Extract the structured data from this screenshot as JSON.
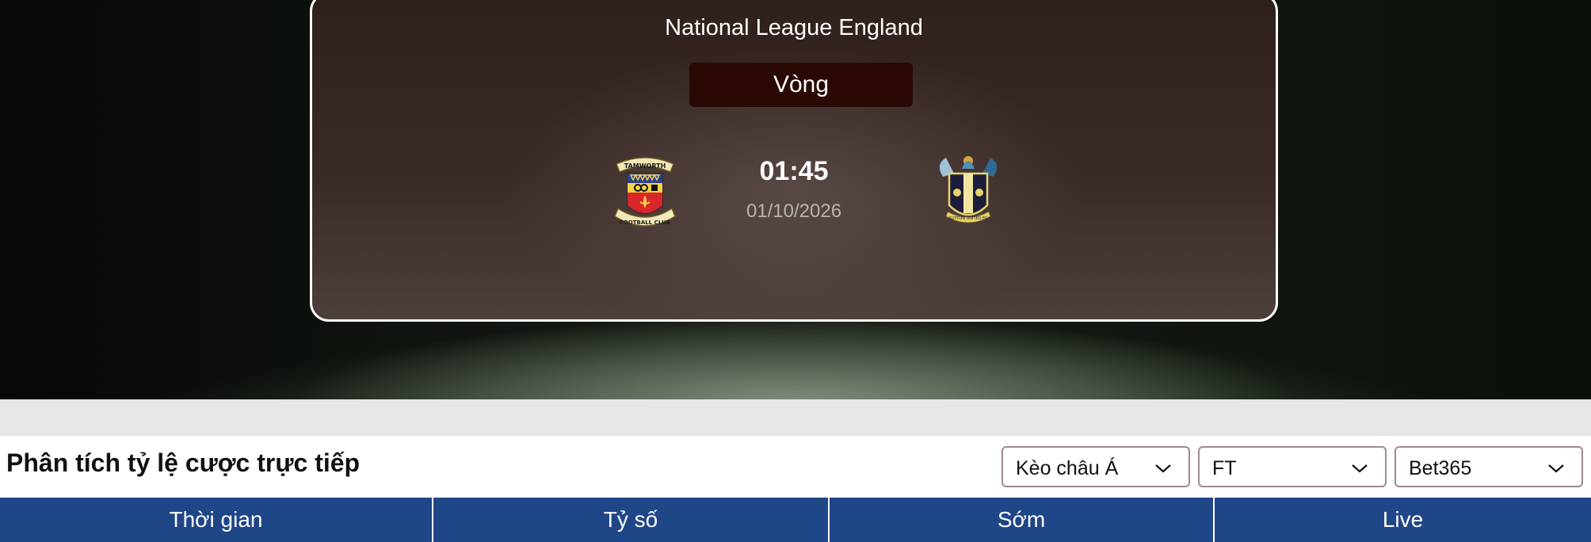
{
  "match": {
    "league": "National League England",
    "round_label": "Vòng",
    "kickoff_time": "01:45",
    "kickoff_date": "01/10/2026",
    "home_logo_text": [
      "TAMWORTH",
      "FOOTBALL CLUB"
    ],
    "away_logo_text": "SUTTON UNITED FC"
  },
  "odds_section": {
    "title": "Phân tích tỷ lệ cược trực tiếp",
    "filters": [
      {
        "value": "Kèo châu Á",
        "icon": "chevron-down-icon"
      },
      {
        "value": "FT",
        "icon": "chevron-down-icon"
      },
      {
        "value": "Bet365",
        "icon": "chevron-down-icon"
      }
    ],
    "columns": [
      "Thời gian",
      "Tỷ số",
      "Sớm",
      "Live"
    ]
  },
  "colors": {
    "table_header_bg": "#1f4687",
    "round_badge_bg": "#2a0905",
    "select_border": "#a08a8a",
    "separator_band": "#e6e6e6"
  }
}
